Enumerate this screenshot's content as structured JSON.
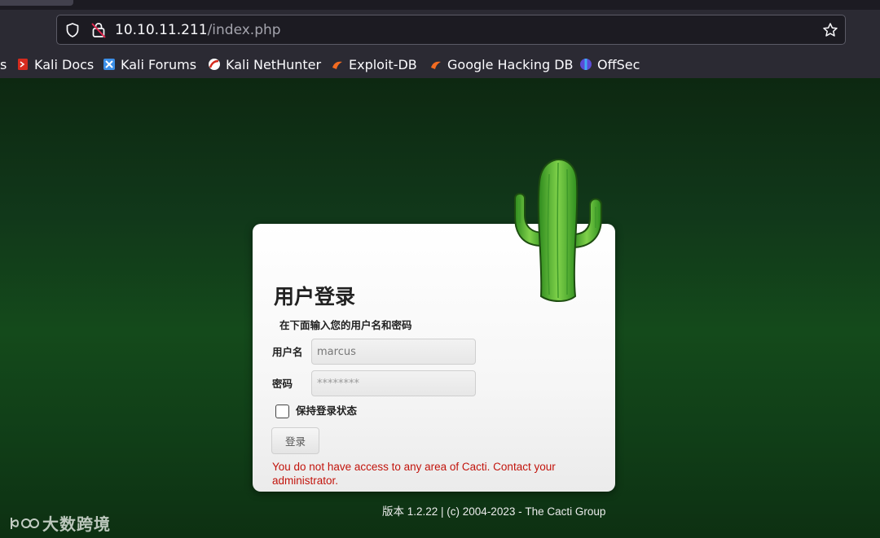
{
  "browser": {
    "url_host": "10.10.11.211",
    "url_path": "/index.php",
    "bookmarks_partial": "s",
    "bookmarks": [
      {
        "label": "Kali Docs",
        "icon": "kali-docs-icon"
      },
      {
        "label": "Kali Forums",
        "icon": "kali-forums-icon"
      },
      {
        "label": "Kali NetHunter",
        "icon": "kali-nethunter-icon"
      },
      {
        "label": "Exploit-DB",
        "icon": "exploit-db-icon"
      },
      {
        "label": "Google Hacking DB",
        "icon": "google-hacking-db-icon"
      },
      {
        "label": "OffSec",
        "icon": "offsec-icon"
      }
    ]
  },
  "login": {
    "title": "用户登录",
    "subtitle": "在下面输入您的用户名和密码",
    "username_label": "用户名",
    "username_value": "marcus",
    "password_label": "密码",
    "password_value": "********",
    "remember_label": "保持登录状态",
    "remember_checked": false,
    "submit_label": "登录",
    "error_message": "You do not have access to any area of Cacti. Contact your administrator."
  },
  "footer": {
    "version_text": "版本 1.2.22 | (c) 2004-2023 - The Cacti Group"
  },
  "watermark": {
    "text": "大数跨境"
  },
  "colors": {
    "background": "#144a1b",
    "error": "#c2140c",
    "chrome": "#2b2a33"
  }
}
